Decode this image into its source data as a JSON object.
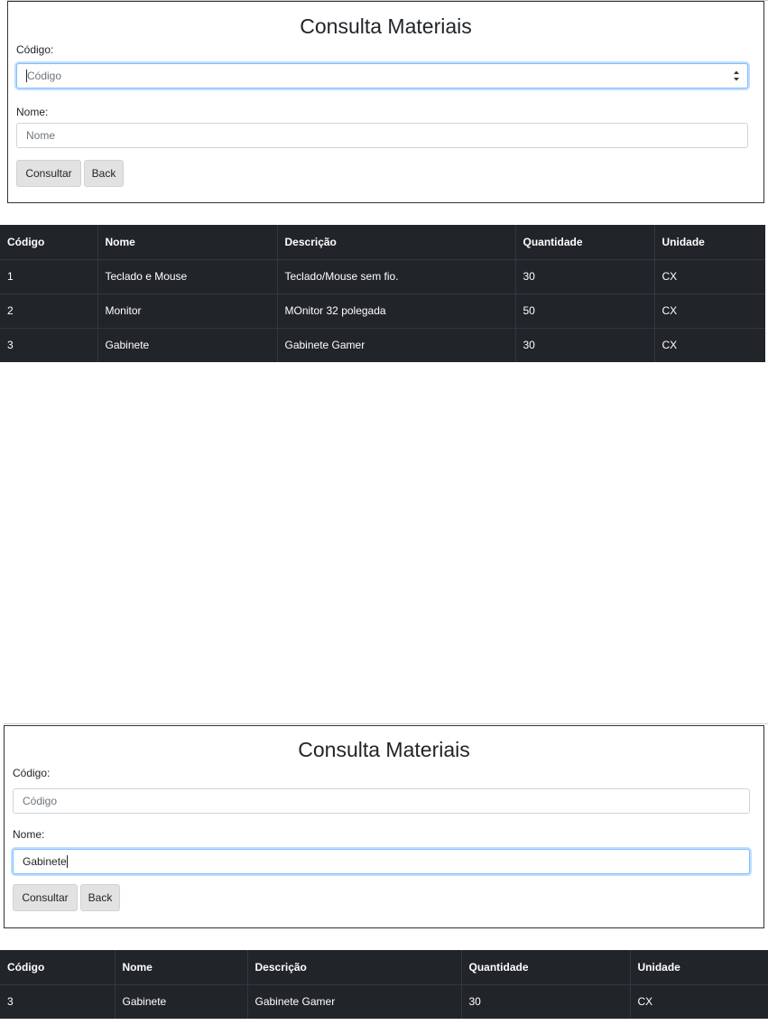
{
  "screens": [
    {
      "form": {
        "title": "Consulta Materiais",
        "codigo_label": "Código:",
        "codigo_placeholder": "Código",
        "codigo_value": "",
        "nome_label": "Nome:",
        "nome_placeholder": "Nome",
        "nome_value": "",
        "consultar_label": "Consultar",
        "back_label": "Back"
      },
      "table": {
        "headers": [
          "Código",
          "Nome",
          "Descrição",
          "Quantidade",
          "Unidade"
        ],
        "rows": [
          [
            "1",
            "Teclado e Mouse",
            "Teclado/Mouse sem fio.",
            "30",
            "CX"
          ],
          [
            "2",
            "Monitor",
            "MOnitor 32 polegada",
            "50",
            "CX"
          ],
          [
            "3",
            "Gabinete",
            "Gabinete Gamer",
            "30",
            "CX"
          ]
        ]
      }
    },
    {
      "form": {
        "title": "Consulta Materiais",
        "codigo_label": "Código:",
        "codigo_placeholder": "Código",
        "codigo_value": "",
        "nome_label": "Nome:",
        "nome_placeholder": "Nome",
        "nome_value": "Gabinete",
        "consultar_label": "Consultar",
        "back_label": "Back"
      },
      "table": {
        "headers": [
          "Código",
          "Nome",
          "Descrição",
          "Quantidade",
          "Unidade"
        ],
        "rows": [
          [
            "3",
            "Gabinete",
            "Gabinete Gamer",
            "30",
            "CX"
          ]
        ]
      }
    }
  ],
  "icons": {
    "spinner": "number-spinner-icon"
  },
  "colors": {
    "table_background": "#212529",
    "button_background": "#e2e2e2",
    "focus_border": "#80bdff"
  }
}
